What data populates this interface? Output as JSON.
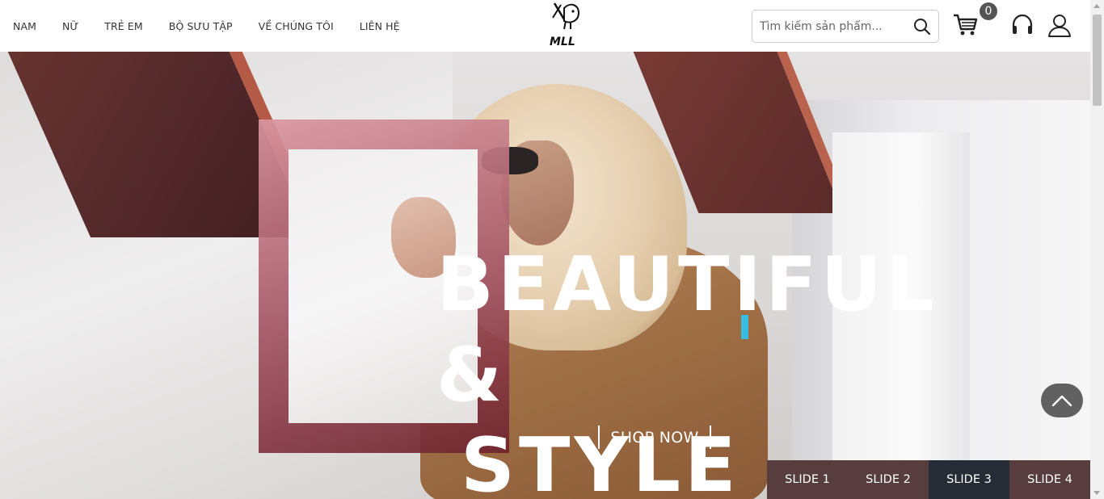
{
  "nav": {
    "items": [
      "NAM",
      "NỮ",
      "TRẺ EM",
      "BỘ SƯU TẬP",
      "VỀ CHÚNG TÔI",
      "LIÊN HỆ"
    ]
  },
  "logo": {
    "text": "MLL"
  },
  "search": {
    "placeholder": "Tìm kiếm sản phẩm...",
    "value": "",
    "icon": "search-icon"
  },
  "cart": {
    "icon": "cart-icon",
    "count": "0"
  },
  "header_icons": [
    "cart-icon",
    "headset-icon",
    "user-icon"
  ],
  "hero": {
    "headline_line1": "BEAUTIFUL &",
    "headline_line2": "STYLE",
    "cta_label": "SHOP NOW",
    "accent_color": "#38bde0",
    "frame_color": "#a0505f"
  },
  "slider": {
    "buttons": [
      "SLIDE 1",
      "SLIDE 2",
      "SLIDE 3",
      "SLIDE 4"
    ],
    "active_index": 2,
    "button_color": "#573d3e",
    "active_color": "#252c36"
  },
  "back_to_top": {
    "icon": "chevron-up-icon"
  }
}
